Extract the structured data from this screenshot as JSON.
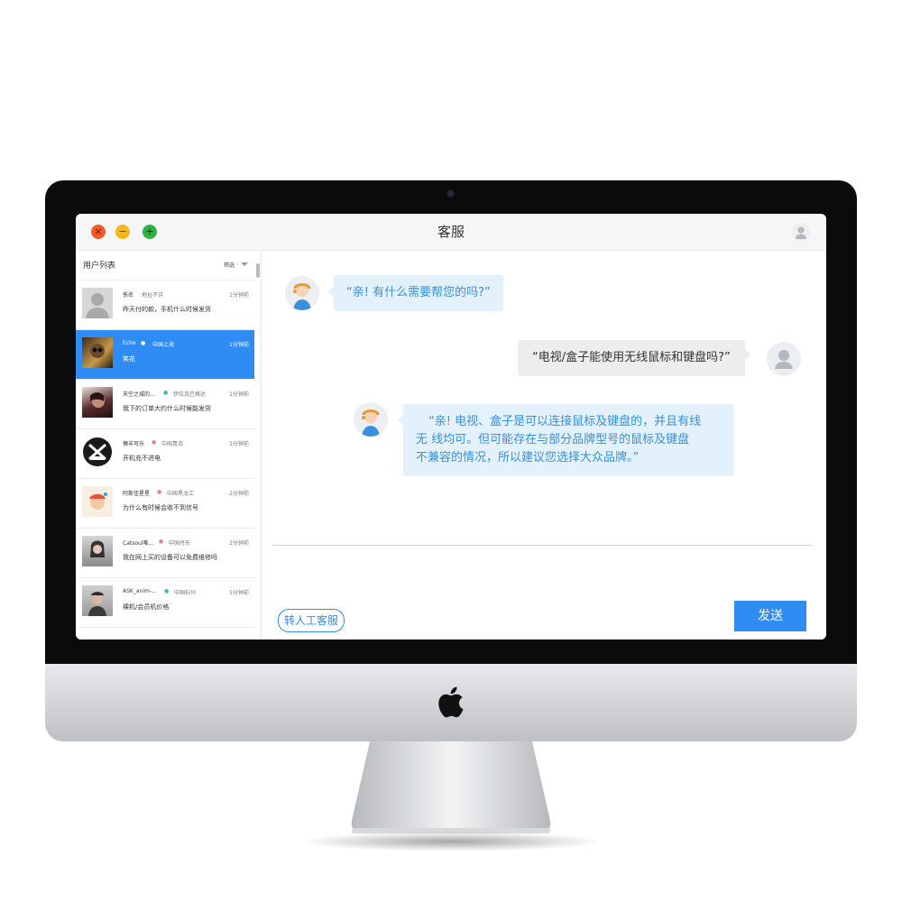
{
  "window": {
    "title": "客服",
    "controls": {
      "close": "×",
      "minimize": "−",
      "maximize": "+"
    }
  },
  "sidebar": {
    "title": "用户列表",
    "filter_label": "筛选",
    "items": [
      {
        "name": "佚名",
        "location": "地址不详",
        "time": "1分钟前",
        "message": "昨天付的款，手机什么时候发货",
        "active": false,
        "avatar": "default-avatar"
      },
      {
        "name": "Echo",
        "location": "中国上海",
        "time": "1分钟前",
        "message": "笑花",
        "active": true,
        "avatar": "photo-avatar"
      },
      {
        "name": "天空之城的...",
        "location": "伊拉克巴格达",
        "time": "1分钟前",
        "message": "我下的订单大约什么时候能发货",
        "active": false,
        "avatar": "photo-avatar"
      },
      {
        "name": "懒羊可乐",
        "location": "中国青岛",
        "time": "1分钟前",
        "message": "开机充不进电",
        "active": false,
        "avatar": "logo-avatar"
      },
      {
        "name": "阿斯佳星星",
        "location": "中国黑龙江",
        "time": "2分钟前",
        "message": "为什么有时候会收不到信号",
        "active": false,
        "avatar": "photo-avatar"
      },
      {
        "name": "Catsoul唯...",
        "location": "中国丹东",
        "time": "2分钟前",
        "message": "我在网上买的设备可以免费维修吗",
        "active": false,
        "avatar": "photo-avatar"
      },
      {
        "name": "ASK_anim-...",
        "location": "中国杭州",
        "time": "5分钟前",
        "message": "裸机/会员机价格",
        "active": false,
        "avatar": "photo-avatar"
      }
    ]
  },
  "chat": {
    "messages": [
      {
        "from": "agent",
        "text": "“亲! 有什么需要帮您的吗?”"
      },
      {
        "from": "user",
        "text": "“电视/盒子能使用无线鼠标和键盘吗?”"
      },
      {
        "from": "agent",
        "lines": [
          "“亲! 电视、盒子是可以连接鼠标及键盘的，并且有线",
          "无 线均可。但可能存在与部分品牌型号的鼠标及键盘",
          "不兼容的情况，所以建议您选择大众品牌。”"
        ]
      }
    ],
    "transfer_label": "转人工客服",
    "send_label": "发送"
  },
  "colors": {
    "accent": "#2f8cf2",
    "agent_bubble": "#e2f1fc",
    "user_bubble": "#ededed"
  }
}
